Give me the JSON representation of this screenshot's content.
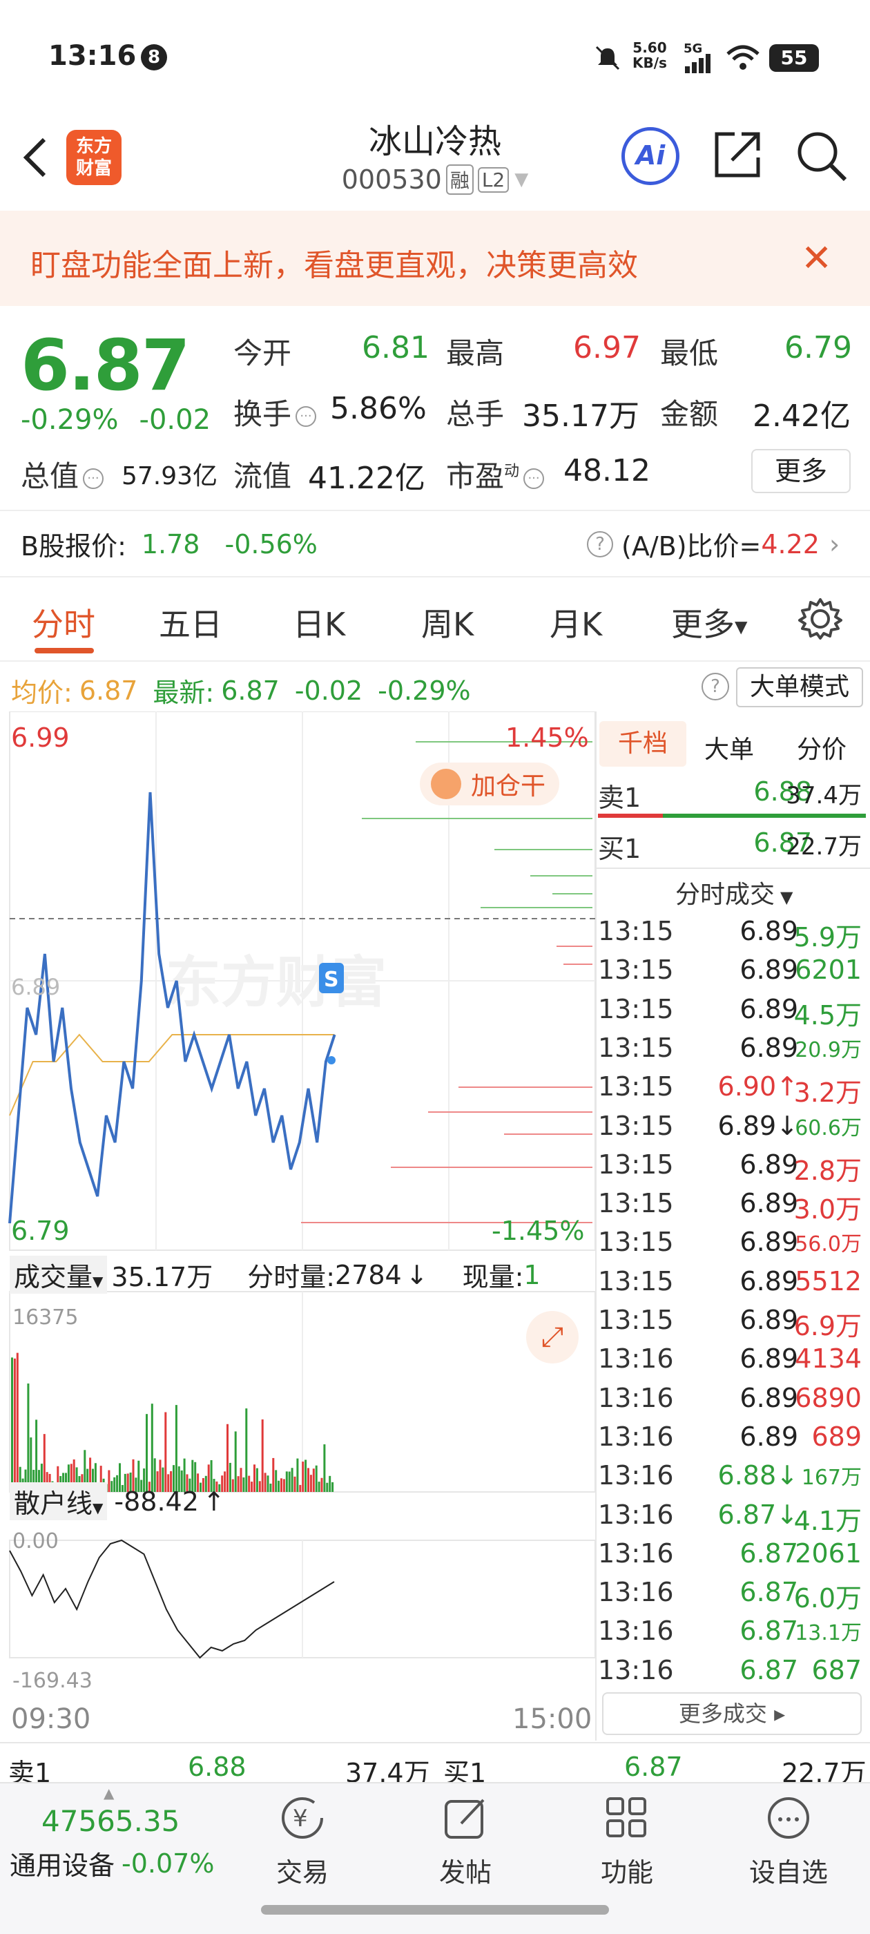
{
  "status_bar": {
    "time": "13:16",
    "notification_count": "8",
    "net_speed": "5.60",
    "net_unit": "KB/s",
    "signal": "5G",
    "battery": "55"
  },
  "header": {
    "logo_line1": "东方",
    "logo_line2": "财富",
    "title": "冰山冷热",
    "code": "000530",
    "tag_margin": "融",
    "tag_level": "L2",
    "ai_label": "Ai"
  },
  "banner": {
    "text": "盯盘功能全面上新，看盘更直观，决策更高效"
  },
  "quote": {
    "price": "6.87",
    "change_pct": "-0.29%",
    "change": "-0.02",
    "open_label": "今开",
    "open": "6.81",
    "high_label": "最高",
    "high": "6.97",
    "low_label": "最低",
    "low": "6.79",
    "turnover_label": "换手",
    "turnover": "5.86%",
    "volume_label": "总手",
    "volume": "35.17万",
    "amount_label": "金额",
    "amount": "2.42亿",
    "mktcap_label": "总值",
    "mktcap": "57.93亿",
    "float_label": "流值",
    "float": "41.22亿",
    "pe_label": "市盈",
    "pe_sup": "动",
    "pe": "48.12",
    "more": "更多"
  },
  "bshare": {
    "label": "B股报价:",
    "price": "1.78",
    "pct": "-0.56%",
    "ratio_label": "(A/B)比价=",
    "ratio": "4.22"
  },
  "tabs": [
    "分时",
    "五日",
    "日K",
    "周K",
    "月K",
    "更多"
  ],
  "avg_row": {
    "avg_label": "均价:",
    "avg": "6.87",
    "last_label": "最新:",
    "last": "6.87",
    "chg": "-0.02",
    "pct": "-0.29%",
    "big_order": "大单模式"
  },
  "chart": {
    "y_max": "6.99",
    "y_min": "6.79",
    "pct_max": "1.45%",
    "pct_min": "-1.45%",
    "prev_close": "6.89",
    "badge": "加仓干",
    "marker": "S",
    "watermark": "东方财富",
    "vol_label": "成交量",
    "vol_total": "35.17万",
    "tick_vol_label": "分时量:",
    "tick_vol": "2784",
    "cur_vol_label": "现量:",
    "cur_vol": "1",
    "vol_max": "16375",
    "retail_label": "散户线",
    "retail_val": "-88.42",
    "retail_max": "0.00",
    "retail_min": "-169.43",
    "time_start": "09:30",
    "time_end": "15:00"
  },
  "chart_data": {
    "type": "line",
    "x_range": [
      "09:30",
      "15:00"
    ],
    "ylim": [
      6.79,
      6.99
    ],
    "series": [
      {
        "values": [
          6.8,
          6.84,
          6.88,
          6.87,
          6.9,
          6.86,
          6.88,
          6.85,
          6.83,
          6.82,
          6.81,
          6.84,
          6.83,
          6.86,
          6.85,
          6.89,
          6.96,
          6.9,
          6.88,
          6.89,
          6.86,
          6.87,
          6.86,
          6.85,
          6.86,
          6.87,
          6.85,
          6.86,
          6.84,
          6.85,
          6.83,
          6.84,
          6.82,
          6.83,
          6.85,
          6.83,
          6.86,
          6.87
        ]
      },
      {
        "values": [
          6.84,
          6.86,
          6.86,
          6.87,
          6.86,
          6.86,
          6.86,
          6.87,
          6.87,
          6.87,
          6.87,
          6.87,
          6.87,
          6.87,
          6.87
        ]
      }
    ]
  },
  "right_panel": {
    "tabs": [
      "千档",
      "大单",
      "分价"
    ],
    "sell1_label": "卖1",
    "sell1_price": "6.88",
    "sell1_vol": "37.4万",
    "buy1_label": "买1",
    "buy1_price": "6.87",
    "buy1_vol": "22.7万",
    "ticks_title": "分时成交",
    "ticks": [
      {
        "t": "13:15",
        "p": "6.89",
        "v": "5.9万",
        "c": "green",
        "pc": "black"
      },
      {
        "t": "13:15",
        "p": "6.89",
        "v": "6201",
        "c": "green",
        "pc": "black"
      },
      {
        "t": "13:15",
        "p": "6.89",
        "v": "4.5万",
        "c": "green",
        "pc": "black"
      },
      {
        "t": "13:15",
        "p": "6.89",
        "v": "20.9万",
        "c": "green",
        "pc": "black",
        "small": true
      },
      {
        "t": "13:15",
        "p": "6.90↑",
        "v": "3.2万",
        "c": "red",
        "pc": "red"
      },
      {
        "t": "13:15",
        "p": "6.89↓",
        "v": "60.6万",
        "c": "green",
        "pc": "black",
        "small": true
      },
      {
        "t": "13:15",
        "p": "6.89",
        "v": "2.8万",
        "c": "red",
        "pc": "black"
      },
      {
        "t": "13:15",
        "p": "6.89",
        "v": "3.0万",
        "c": "red",
        "pc": "black"
      },
      {
        "t": "13:15",
        "p": "6.89",
        "v": "56.0万",
        "c": "red",
        "pc": "black",
        "small": true
      },
      {
        "t": "13:15",
        "p": "6.89",
        "v": "5512",
        "c": "red",
        "pc": "black"
      },
      {
        "t": "13:15",
        "p": "6.89",
        "v": "6.9万",
        "c": "red",
        "pc": "black"
      },
      {
        "t": "13:16",
        "p": "6.89",
        "v": "4134",
        "c": "red",
        "pc": "black"
      },
      {
        "t": "13:16",
        "p": "6.89",
        "v": "6890",
        "c": "red",
        "pc": "black"
      },
      {
        "t": "13:16",
        "p": "6.89",
        "v": "689",
        "c": "red",
        "pc": "black"
      },
      {
        "t": "13:16",
        "p": "6.88↓",
        "v": "167万",
        "c": "green",
        "pc": "green",
        "small": true
      },
      {
        "t": "13:16",
        "p": "6.87↓",
        "v": "4.1万",
        "c": "green",
        "pc": "green"
      },
      {
        "t": "13:16",
        "p": "6.87",
        "v": "2061",
        "c": "green",
        "pc": "green"
      },
      {
        "t": "13:16",
        "p": "6.87",
        "v": "6.0万",
        "c": "green",
        "pc": "green"
      },
      {
        "t": "13:16",
        "p": "6.87",
        "v": "13.1万",
        "c": "green",
        "pc": "green",
        "small": true
      },
      {
        "t": "13:16",
        "p": "6.87",
        "v": "687",
        "c": "green",
        "pc": "green"
      }
    ],
    "more_ticks": "更多成交"
  },
  "bottom_quote": {
    "sell1_label": "卖1",
    "sell1_price": "6.88",
    "sell1_vol": "37.4万",
    "buy1_label": "买1",
    "buy1_price": "6.87",
    "buy1_vol": "22.7万"
  },
  "bottom_nav": {
    "index_value": "47565.35",
    "index_name": "通用设备",
    "index_pct": "-0.07%",
    "trade": "交易",
    "post": "发帖",
    "func": "功能",
    "watch": "设自选"
  }
}
